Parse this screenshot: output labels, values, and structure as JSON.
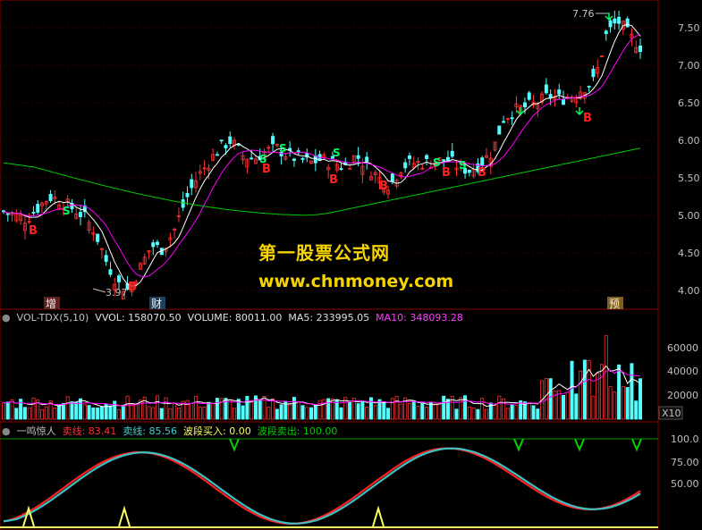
{
  "watermark": {
    "line1": "第一股票公式网",
    "line2": "www.chnmoney.com"
  },
  "price_panel": {
    "y_ticks": [
      "7.50",
      "7.00",
      "6.50",
      "6.00",
      "5.50",
      "5.00",
      "4.50",
      "4.00"
    ],
    "high_label": "7.76",
    "low_label": "3.97",
    "period_marks": [
      "增",
      "财",
      "预"
    ],
    "buy_marker": "B",
    "sell_marker": "S"
  },
  "volume_panel": {
    "indicator": "VOL-TDX(5,10)",
    "vvol": "VVOL: 158070.50",
    "volume": "VOLUME: 80011.00",
    "ma5": "MA5: 233995.05",
    "ma10": "MA10: 348093.28",
    "y_ticks": [
      "60000",
      "40000",
      "20000"
    ],
    "unit": "X10"
  },
  "oscillator_panel": {
    "name": "一鸣惊人",
    "sell_line": "卖线: 83.41",
    "sell_line2": "卖线: 85.56",
    "wave_buy": "波段买入: 0.00",
    "wave_sell": "波段卖出: 100.00",
    "y_ticks": [
      "100.0",
      "75.00",
      "50.00"
    ]
  },
  "colors": {
    "up": "#ff3232",
    "down": "#54ffff",
    "ma_white": "#ffffff",
    "ma_magenta": "#ff00ff",
    "ma_green": "#00c800",
    "grid": "#8b0000",
    "axis_text": "#c0c0c0",
    "osc_red": "#ff2020",
    "osc_cyan": "#40c0c0",
    "buy_yellow": "#ffff60",
    "sell_green": "#00d000"
  },
  "chart_data": {
    "type": "candlestick",
    "ylim_price": [
      3.8,
      7.8
    ],
    "ylim_volume": [
      0,
      80000
    ],
    "ylim_oscillator": [
      0,
      110
    ],
    "series_close_approx": [
      5.05,
      5.0,
      4.95,
      5.1,
      5.25,
      5.2,
      5.1,
      5.0,
      4.8,
      4.4,
      4.1,
      4.0,
      4.3,
      4.6,
      4.55,
      4.8,
      5.2,
      5.5,
      5.7,
      5.9,
      6.0,
      5.8,
      5.75,
      5.85,
      5.9,
      5.8,
      5.75,
      5.7,
      5.75,
      5.7,
      5.65,
      5.8,
      5.65,
      5.5,
      5.4,
      5.65,
      5.7,
      5.7,
      5.72,
      5.75,
      5.65,
      5.6,
      5.7,
      5.85,
      6.3,
      6.4,
      6.45,
      6.5,
      6.6,
      6.55,
      6.6,
      6.7,
      6.8,
      7.4,
      7.6,
      7.4,
      7.25
    ],
    "price_high": 7.76,
    "price_low": 3.97,
    "oscillator_levels": [
      100.0,
      75.0,
      50.0
    ]
  }
}
